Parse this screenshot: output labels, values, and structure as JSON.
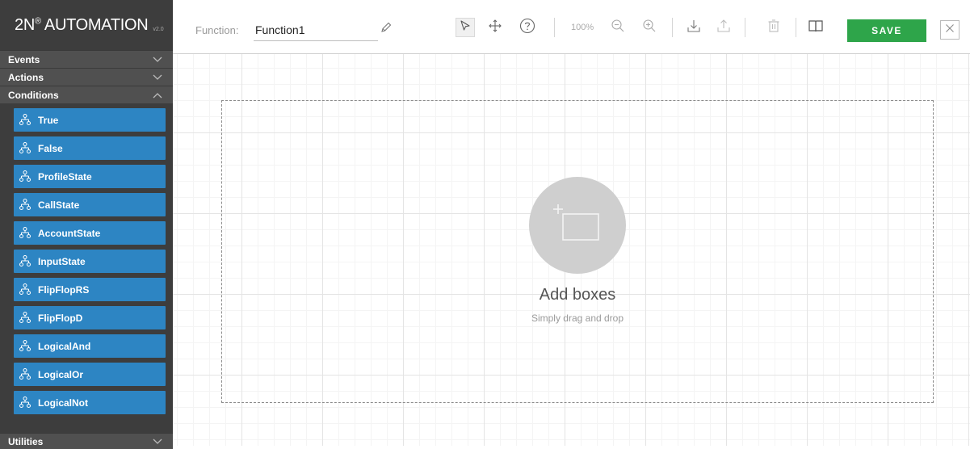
{
  "app": {
    "brand": "2N",
    "brand_mark": "®",
    "brand_rest": " AUTOMATION",
    "version": "v2.0"
  },
  "sidebar": {
    "sections": {
      "events": "Events",
      "actions": "Actions",
      "conditions": "Conditions",
      "utilities": "Utilities"
    },
    "conditions": [
      "True",
      "False",
      "ProfileState",
      "CallState",
      "AccountState",
      "InputState",
      "FlipFlopRS",
      "FlipFlopD",
      "LogicalAnd",
      "LogicalOr",
      "LogicalNot"
    ]
  },
  "toolbar": {
    "function_label": "Function:",
    "function_value": "Function1",
    "zoom_level": "100%",
    "save_label": "SAVE"
  },
  "canvas": {
    "add_title": "Add boxes",
    "add_subtitle": "Simply drag and drop"
  },
  "colors": {
    "sidebar_bg": "#3d3d3d",
    "item_blue": "#2d85c3",
    "save_green": "#2ea54a"
  },
  "icons": {
    "item": "condition-tree-icon",
    "pointer": "pointer-icon",
    "move": "move-icon",
    "help": "help-icon",
    "zoom_out": "zoom-out-icon",
    "zoom_in": "zoom-in-icon",
    "download": "download-icon",
    "upload": "upload-icon",
    "delete": "trash-icon",
    "docs": "book-icon",
    "close": "close-icon"
  }
}
